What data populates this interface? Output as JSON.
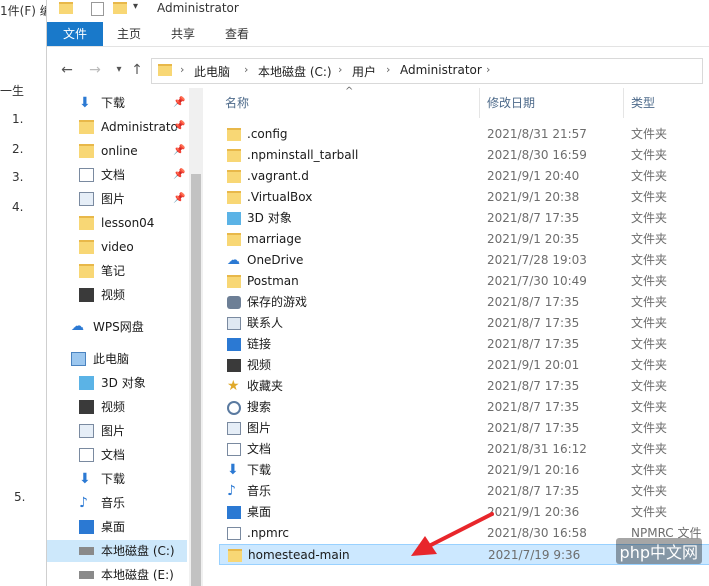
{
  "background_window": {
    "menu": "1件(F)  编",
    "tree": [
      "一生",
      "1.",
      "2.",
      "3.",
      "4.",
      "5."
    ]
  },
  "window": {
    "title": "Administrator"
  },
  "ribbon": {
    "tabs": [
      "文件",
      "主页",
      "共享",
      "查看"
    ]
  },
  "address": {
    "crumbs": [
      "此电脑",
      "本地磁盘 (C:)",
      "用户",
      "Administrator"
    ]
  },
  "nav": {
    "items": [
      {
        "label": "下载",
        "icon": "download-icon",
        "pinned": true
      },
      {
        "label": "Administrato",
        "icon": "folder-icon",
        "pinned": true
      },
      {
        "label": "online",
        "icon": "folder-icon",
        "pinned": true
      },
      {
        "label": "文档",
        "icon": "document-icon",
        "pinned": true
      },
      {
        "label": "图片",
        "icon": "picture-icon",
        "pinned": true
      },
      {
        "label": "lesson04",
        "icon": "folder-icon",
        "pinned": false
      },
      {
        "label": "video",
        "icon": "folder-icon",
        "pinned": false
      },
      {
        "label": "笔记",
        "icon": "folder-icon",
        "pinned": false
      },
      {
        "label": "视频",
        "icon": "video-icon",
        "pinned": false
      },
      {
        "label": "WPS网盘",
        "icon": "cloud-icon",
        "pinned": false
      },
      {
        "label": "此电脑",
        "icon": "computer-icon",
        "pinned": false
      },
      {
        "label": "3D 对象",
        "icon": "3d-objects-icon",
        "pinned": false
      },
      {
        "label": "视频",
        "icon": "video-icon",
        "pinned": false
      },
      {
        "label": "图片",
        "icon": "picture-icon",
        "pinned": false
      },
      {
        "label": "文档",
        "icon": "document-icon",
        "pinned": false
      },
      {
        "label": "下载",
        "icon": "download-icon",
        "pinned": false
      },
      {
        "label": "音乐",
        "icon": "music-icon",
        "pinned": false
      },
      {
        "label": "桌面",
        "icon": "desktop-icon",
        "pinned": false
      },
      {
        "label": "本地磁盘 (C:)",
        "icon": "drive-icon",
        "pinned": false,
        "selected": true
      },
      {
        "label": "本地磁盘 (E:)",
        "icon": "drive-icon",
        "pinned": false
      }
    ]
  },
  "columns": {
    "name": "名称",
    "date": "修改日期",
    "type": "类型"
  },
  "files": [
    {
      "name": ".config",
      "date": "2021/8/31 21:57",
      "type": "文件夹",
      "icon": "folder-icon"
    },
    {
      "name": ".npminstall_tarball",
      "date": "2021/8/30 16:59",
      "type": "文件夹",
      "icon": "folder-icon"
    },
    {
      "name": ".vagrant.d",
      "date": "2021/9/1 20:40",
      "type": "文件夹",
      "icon": "folder-icon"
    },
    {
      "name": ".VirtualBox",
      "date": "2021/9/1 20:38",
      "type": "文件夹",
      "icon": "folder-icon"
    },
    {
      "name": "3D 对象",
      "date": "2021/8/7 17:35",
      "type": "文件夹",
      "icon": "3d-objects-icon"
    },
    {
      "name": "marriage",
      "date": "2021/9/1 20:35",
      "type": "文件夹",
      "icon": "folder-icon"
    },
    {
      "name": "OneDrive",
      "date": "2021/7/28 19:03",
      "type": "文件夹",
      "icon": "cloud-icon"
    },
    {
      "name": "Postman",
      "date": "2021/7/30 10:49",
      "type": "文件夹",
      "icon": "folder-icon"
    },
    {
      "name": "保存的游戏",
      "date": "2021/8/7 17:35",
      "type": "文件夹",
      "icon": "saved-games-icon"
    },
    {
      "name": "联系人",
      "date": "2021/8/7 17:35",
      "type": "文件夹",
      "icon": "contacts-icon"
    },
    {
      "name": "链接",
      "date": "2021/8/7 17:35",
      "type": "文件夹",
      "icon": "links-icon"
    },
    {
      "name": "视频",
      "date": "2021/9/1 20:01",
      "type": "文件夹",
      "icon": "video-icon"
    },
    {
      "name": "收藏夹",
      "date": "2021/8/7 17:35",
      "type": "文件夹",
      "icon": "favorites-icon"
    },
    {
      "name": "搜索",
      "date": "2021/8/7 17:35",
      "type": "文件夹",
      "icon": "search-icon"
    },
    {
      "name": "图片",
      "date": "2021/8/7 17:35",
      "type": "文件夹",
      "icon": "picture-icon"
    },
    {
      "name": "文档",
      "date": "2021/8/31 16:12",
      "type": "文件夹",
      "icon": "document-icon"
    },
    {
      "name": "下载",
      "date": "2021/9/1 20:16",
      "type": "文件夹",
      "icon": "download-icon"
    },
    {
      "name": "音乐",
      "date": "2021/8/7 17:35",
      "type": "文件夹",
      "icon": "music-icon"
    },
    {
      "name": "桌面",
      "date": "2021/9/1 20:36",
      "type": "文件夹",
      "icon": "desktop-icon"
    },
    {
      "name": ".npmrc",
      "date": "2021/8/30 16:58",
      "type": "NPMRC 文件",
      "icon": "file-icon"
    },
    {
      "name": "homestead-main",
      "date": "2021/7/19 9:36",
      "type": "",
      "icon": "folder-icon",
      "selected": true
    }
  ],
  "watermark": "php中文网",
  "colors": {
    "accent": "#1979ca",
    "selection": "#cce8ff",
    "arrow": "#e8262b"
  }
}
